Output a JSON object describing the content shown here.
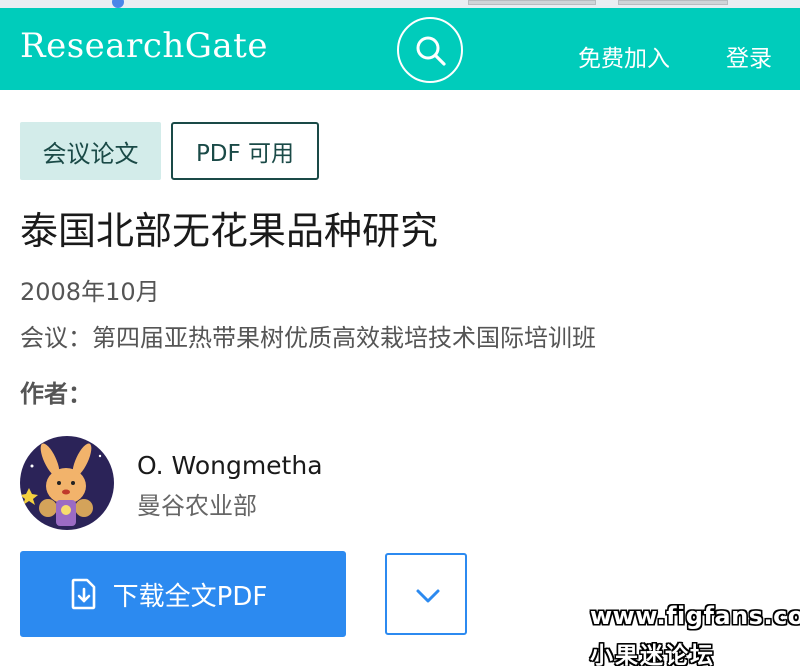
{
  "header": {
    "logo": "ResearchGate",
    "search_icon": "search-icon",
    "join_label": "免费加入",
    "login_label": "登录",
    "accent_color": "#00ccbb"
  },
  "publication": {
    "type_tag": "会议论文",
    "pdf_tag": "PDF 可用",
    "title": "泰国北部无花果品种研究",
    "date": "2008年10月",
    "conference": "会议：第四届亚热带果树优质高效栽培技术国际培训班",
    "authors_label": "作者："
  },
  "authors": [
    {
      "name": "O. Wongmetha",
      "affiliation": "曼谷农业部",
      "avatar_icon": "rabbit-avatar"
    }
  ],
  "actions": {
    "download_label": "下载全文PDF",
    "download_icon": "file-download-icon",
    "more_icon": "chevron-down-icon",
    "button_color": "#2c8af0"
  },
  "watermark": {
    "url": "www.figfans.com",
    "name": "小果迷论坛"
  }
}
